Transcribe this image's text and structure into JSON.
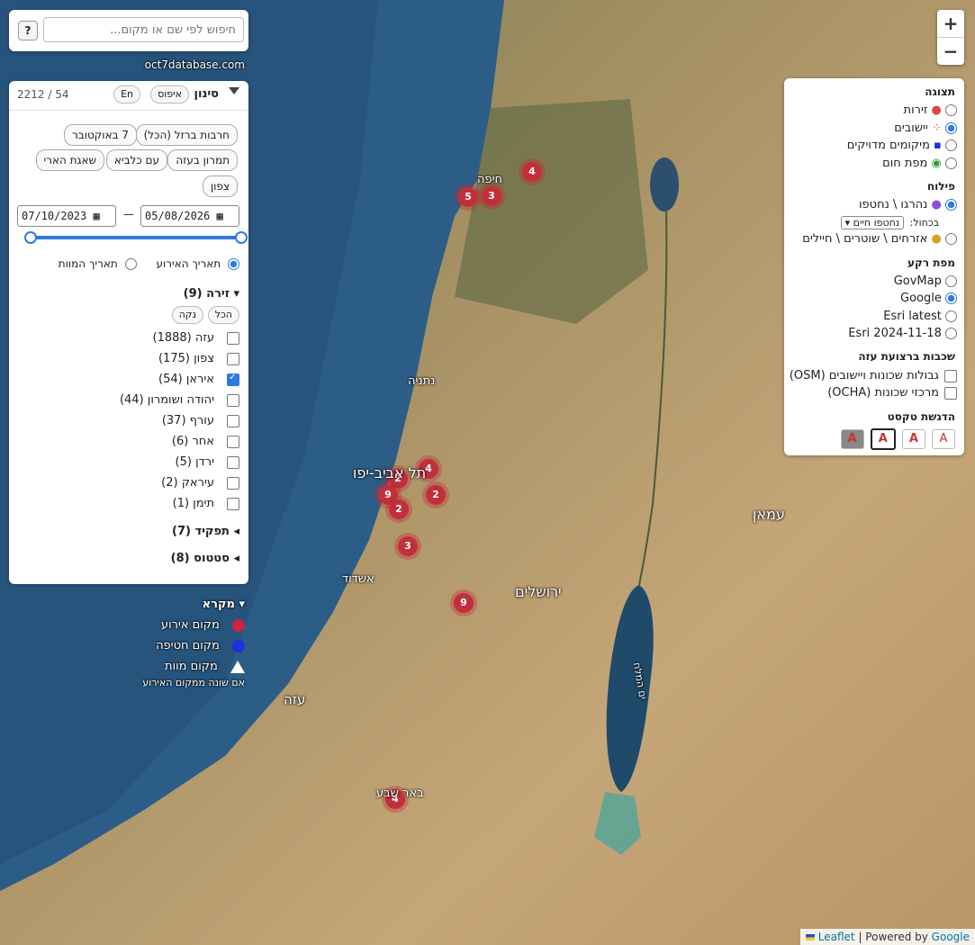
{
  "search": {
    "placeholder": "חיפוש לפי שם או מקום...",
    "help_label": "?"
  },
  "site_link": "oct7database.com",
  "filter": {
    "title": "סינון",
    "reset_label": "איפוס",
    "lang_label": "En",
    "count": "2212 / 54",
    "quick_filters": [
      "7 באוקטובר",
      "חרבות ברזל (הכל)",
      "שאגת הארי",
      "עם כלביא",
      "תמרון בעזה",
      "צפון"
    ],
    "date_from": "07/10/2023",
    "date_to": "05/08/2026",
    "date_sep": "—",
    "date_mode": {
      "event_label": "תאריך האירוע",
      "death_label": "תאריך המוות",
      "selected": "event"
    },
    "arena": {
      "title": "זירה (9)",
      "all_label": "הכל",
      "clear_label": "נקה",
      "items": [
        {
          "label": "עזה (1888)",
          "checked": false
        },
        {
          "label": "צפון (175)",
          "checked": false
        },
        {
          "label": "איראן (54)",
          "checked": true
        },
        {
          "label": "יהודה ושומרון (44)",
          "checked": false
        },
        {
          "label": "עורף (37)",
          "checked": false
        },
        {
          "label": "אחר (6)",
          "checked": false
        },
        {
          "label": "ירדן (5)",
          "checked": false
        },
        {
          "label": "עיראק (2)",
          "checked": false
        },
        {
          "label": "תימן (1)",
          "checked": false
        }
      ]
    },
    "role_title": "תפקיד (7)",
    "status_title": "סטטוס (8)"
  },
  "legend": {
    "title": "מקרא",
    "items": [
      {
        "label": "מקום אירוע",
        "color": "#c8283a"
      },
      {
        "label": "מקום חטיפה",
        "color": "#1f2ee0"
      },
      {
        "label": "מקום מוות",
        "color": "#ffffff"
      }
    ],
    "note": "אם שונה ממקום האירוע"
  },
  "display": {
    "title": "תצוגה",
    "options": [
      {
        "label": "זירות",
        "selected": false
      },
      {
        "label": "יישובים",
        "selected": true
      },
      {
        "label": "מיקומים מדויקים",
        "selected": false
      },
      {
        "label": "מפת חום",
        "selected": false
      }
    ],
    "breakdown_title": "פילוח",
    "breakdown": [
      {
        "label": "נהרגו \\ נחטפו",
        "selected": true
      },
      {
        "label": "אזרחים \\ שוטרים \\ חיילים",
        "selected": false
      }
    ],
    "color_by_label": "בכחול:",
    "color_by_value": "נחטפו חיים",
    "basemap_title": "מפת רקע",
    "basemaps": [
      {
        "label": "GovMap",
        "selected": false
      },
      {
        "label": "Google",
        "selected": true
      },
      {
        "label": "Esri latest",
        "selected": false
      },
      {
        "label": "Esri 2024-11-18",
        "selected": false
      }
    ],
    "gaza_layers_title": "שכבות ברצועת עזה",
    "gaza_layers": [
      {
        "label": "גבולות שכונות ויישובים (OSM)",
        "checked": false
      },
      {
        "label": "מרכזי שכונות (OCHA)",
        "checked": false
      }
    ],
    "text_highlight_title": "הדגשת טקסט",
    "text_highlight_options": [
      "A",
      "A",
      "A",
      "A"
    ]
  },
  "zoom": {
    "in_label": "+",
    "out_label": "−"
  },
  "attribution": {
    "leaflet": "Leaflet",
    "sep": " | Powered by ",
    "google": "Google"
  },
  "clusters": [
    "4",
    "5",
    "3",
    "2",
    "4",
    "9",
    "2",
    "2",
    "3",
    "9",
    "4"
  ],
  "map_labels": [
    "ירושלים",
    "תל אביב-יפו",
    "אשדוד",
    "עמאן",
    "באר שבע",
    "חיפה",
    "נתניה",
    "עזה",
    "ים המלח"
  ]
}
